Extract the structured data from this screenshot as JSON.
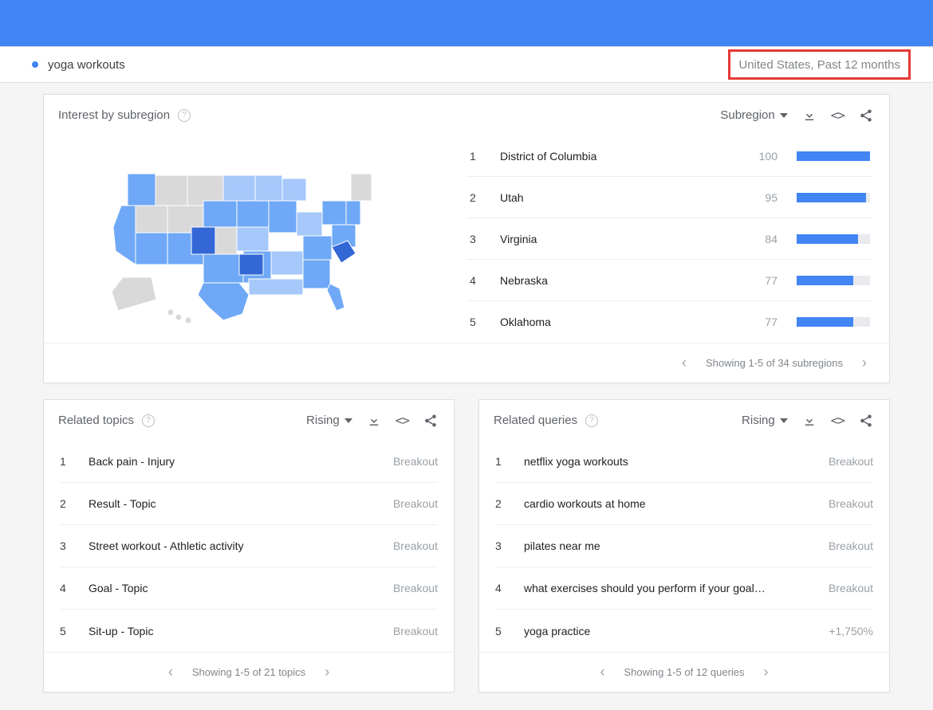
{
  "filter": {
    "term": "yoga workouts",
    "scope": "United States, Past 12 months"
  },
  "interest": {
    "title": "Interest by subregion",
    "dropdown": "Subregion",
    "rows": [
      {
        "rank": "1",
        "name": "District of Columbia",
        "value": "100"
      },
      {
        "rank": "2",
        "name": "Utah",
        "value": "95"
      },
      {
        "rank": "3",
        "name": "Virginia",
        "value": "84"
      },
      {
        "rank": "4",
        "name": "Nebraska",
        "value": "77"
      },
      {
        "rank": "5",
        "name": "Oklahoma",
        "value": "77"
      }
    ],
    "pager": "Showing 1-5 of 34 subregions"
  },
  "related_topics": {
    "title": "Related topics",
    "dropdown": "Rising",
    "rows": [
      {
        "rank": "1",
        "name": "Back pain - Injury",
        "value": "Breakout"
      },
      {
        "rank": "2",
        "name": "Result - Topic",
        "value": "Breakout"
      },
      {
        "rank": "3",
        "name": "Street workout - Athletic activity",
        "value": "Breakout"
      },
      {
        "rank": "4",
        "name": "Goal - Topic",
        "value": "Breakout"
      },
      {
        "rank": "5",
        "name": "Sit-up - Topic",
        "value": "Breakout"
      }
    ],
    "pager": "Showing 1-5 of 21 topics"
  },
  "related_queries": {
    "title": "Related queries",
    "dropdown": "Rising",
    "rows": [
      {
        "rank": "1",
        "name": "netflix yoga workouts",
        "value": "Breakout"
      },
      {
        "rank": "2",
        "name": "cardio workouts at home",
        "value": "Breakout"
      },
      {
        "rank": "3",
        "name": "pilates near me",
        "value": "Breakout"
      },
      {
        "rank": "4",
        "name": "what exercises should you perform if your goal…",
        "value": "Breakout"
      },
      {
        "rank": "5",
        "name": "yoga practice",
        "value": "+1,750%"
      }
    ],
    "pager": "Showing 1-5 of 12 queries"
  },
  "chart_data": {
    "type": "bar",
    "title": "Interest by subregion",
    "categories": [
      "District of Columbia",
      "Utah",
      "Virginia",
      "Nebraska",
      "Oklahoma"
    ],
    "values": [
      100,
      95,
      84,
      77,
      77
    ],
    "xlabel": "",
    "ylabel": "Interest",
    "ylim": [
      0,
      100
    ]
  }
}
